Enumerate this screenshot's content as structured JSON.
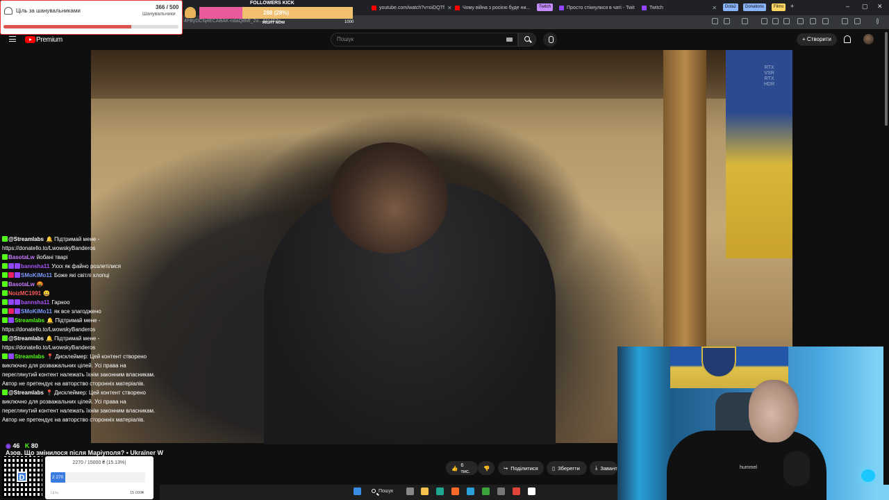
{
  "browser": {
    "tabs": [
      {
        "title": "youtube.com/watch?v=oiDQTf",
        "color": "#ff0000"
      },
      {
        "title": "Чому війна з росією буде ни...",
        "color": "#ff0000"
      },
      {
        "title": "Просто стікнулися в чаті - Twit",
        "color": "#9146ff"
      },
      {
        "title": "Twitch",
        "color": "#9146ff"
      }
    ],
    "tab_groups": [
      {
        "label": "Twitch",
        "color": "#c58af9"
      },
      {
        "label": "Dota2",
        "color": "#8ab4f8"
      },
      {
        "label": "Donations",
        "color": "#8ab4f8"
      },
      {
        "label": "Films",
        "color": "#fdd663"
      }
    ],
    "url_fragment": "4FByDCfq4ECABAK-ndaQ8Mf_2o...&t=463s",
    "window_controls": [
      "–",
      "▢",
      "✕"
    ]
  },
  "youtube": {
    "logo_text": "Premium",
    "search_placeholder": "Пошук",
    "create_label": "Створити",
    "video_title": "Азов. Що змінилося після Маріуполя? • Ukraїner W",
    "rtx_badge": [
      "RTX",
      "VSR",
      "RTX",
      "HDR"
    ],
    "actions": [
      {
        "label": "6 тис.",
        "icon": "thumbs-up-icon"
      },
      {
        "label": "",
        "icon": "thumbs-down-icon"
      },
      {
        "label": "Поділитися",
        "icon": "share-icon"
      },
      {
        "label": "Зберегти",
        "icon": "bookmark-icon"
      },
      {
        "label": "Завант",
        "icon": "download-icon"
      }
    ]
  },
  "goal_widget": {
    "title": "Ціль за шанувальниками",
    "count": "366 / 500",
    "subtitle": "Шанувальники",
    "progress": 0.732,
    "accent": "#d9534f"
  },
  "kick_widget": {
    "label": "FOLLOWERS KICK",
    "value_text": "288 (28%)",
    "progress": 0.28,
    "sub": "RIGHT NOW",
    "max": "1000"
  },
  "chat": {
    "messages": [
      {
        "name": "@Streamlabs",
        "color": "#ffffff",
        "badges": [
          "#53fc18"
        ],
        "text": "🔔 Підтримай мене - https://donatello.to/LwowskyBanderos"
      },
      {
        "name": "BasotaLw",
        "color": "#c97bff",
        "badges": [
          "#53fc18"
        ],
        "text": "йобані тварі"
      },
      {
        "name": "bannsha11",
        "color": "#a855f7",
        "badges": [
          "#53fc18",
          "#9146ff",
          "#9146ff"
        ],
        "text": "Ухxх як файно розлетілися"
      },
      {
        "name": "SMoKiMo11",
        "color": "#7a9cff",
        "badges": [
          "#53fc18",
          "#e91e63",
          "#9146ff"
        ],
        "text": "Боже які світлі хлопці"
      },
      {
        "name": "BasotaLw",
        "color": "#c97bff",
        "badges": [
          "#53fc18"
        ],
        "text": "🤬"
      },
      {
        "name": "NoizMC1991",
        "color": "#ff5a5a",
        "badges": [
          "#53fc18"
        ],
        "text": "😀"
      },
      {
        "name": "bannsha11",
        "color": "#a855f7",
        "badges": [
          "#53fc18",
          "#9146ff",
          "#9146ff"
        ],
        "text": "Гарноо"
      },
      {
        "name": "SMoKiMo11",
        "color": "#7a9cff",
        "badges": [
          "#53fc18",
          "#e91e63",
          "#9146ff"
        ],
        "text": "як все злагоджено"
      },
      {
        "name": "Streamlabs",
        "color": "#53fc18",
        "badges": [
          "#53fc18",
          "#9146ff"
        ],
        "text": "🔔 Підтримай мене - https://donatello.to/LwowskyBanderos"
      },
      {
        "name": "@Streamlabs",
        "color": "#ffffff",
        "badges": [
          "#53fc18"
        ],
        "text": "🔔 Підтримай мене - https://donatello.to/LwowskyBanderos"
      },
      {
        "name": "Streamlabs",
        "color": "#53fc18",
        "badges": [
          "#53fc18",
          "#9146ff"
        ],
        "text": "📍 Дисклеймер: Цей контент створено виключно для розважальних цілей. Усі права на переглянутий контент належать їхнім законним власникам. Автор не претендує на авторство сторонніх матеріалів."
      },
      {
        "name": "@Streamlabs",
        "color": "#ffffff",
        "badges": [
          "#53fc18"
        ],
        "text": "📍 Дисклеймер: Цей контент створено виключно для розважальних цілей. Усі права на переглянутий контент належать їхнім законним власникам. Автор не претендує на авторство сторонніх матеріалів."
      }
    ],
    "viewers_twitch": "46",
    "viewers_kick": "80"
  },
  "donation_widget": {
    "text": "2270 / 15000 ₴ (15.13%)",
    "current": "2 270",
    "progress": 0.1513,
    "min_label": "Ціль",
    "max_label": "15 000₴",
    "qr_letter": "D"
  },
  "webcam": {
    "brand": "hummel"
  },
  "taskbar": {
    "search_label": "Пошук",
    "icons": [
      {
        "name": "windows-start-icon",
        "color": "#3a8ee6"
      },
      {
        "name": "task-view-icon",
        "color": "#888888"
      },
      {
        "name": "file-explorer-icon",
        "color": "#f2c14e"
      },
      {
        "name": "edge-icon",
        "color": "#1fa88f"
      },
      {
        "name": "firefox-icon",
        "color": "#ff6a2a"
      },
      {
        "name": "telegram-icon",
        "color": "#2aa1da"
      },
      {
        "name": "xbox-icon",
        "color": "#3aa53a"
      },
      {
        "name": "obs-icon",
        "color": "#777777"
      },
      {
        "name": "chrome-icon",
        "color": "#e3443a"
      },
      {
        "name": "steam-icon",
        "color": "#ffffff"
      }
    ]
  }
}
